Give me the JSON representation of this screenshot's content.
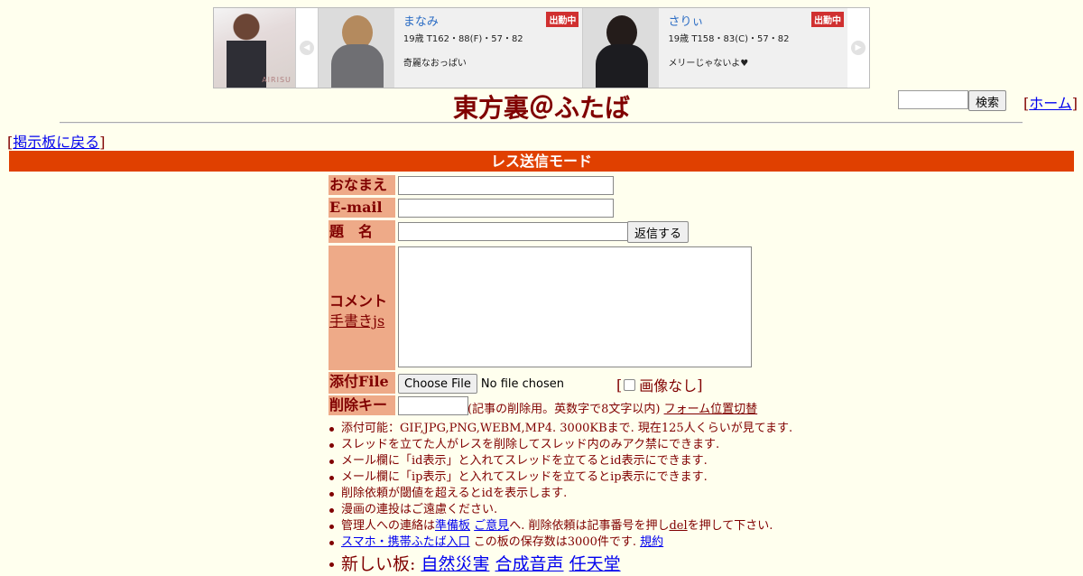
{
  "banner": {
    "shop_logo_text": "AIRISU",
    "prev_arrow": "◀",
    "next_arrow": "▶",
    "girls": [
      {
        "name": "まなみ",
        "spec": "19歳 T162・88(F)・57・82",
        "comment": "奇麗なおっぱい",
        "badge": "出勤中"
      },
      {
        "name": "さりぃ",
        "spec": "19歳 T158・83(C)・57・82",
        "comment": "メリーじゃないよ♥",
        "badge": "出勤中"
      }
    ]
  },
  "header": {
    "title": "東方裏＠ふたば",
    "search_button": "検索",
    "home_link": "ホーム",
    "back_link": "掲示板に戻る"
  },
  "mode_bar": "レス送信モード",
  "form": {
    "name_label": "おなまえ",
    "email_label": "E-mail",
    "subject_label": "題　名",
    "submit_button": "返信する",
    "comment_label": "コメント",
    "handwriting_link": "手書きjs",
    "file_label": "添付File",
    "choose_file_button": "Choose File",
    "no_file_text": "No file chosen",
    "no_image_label": "画像なし",
    "delete_key_label": "削除キー",
    "delete_note": "(記事の削除用。英数字で8文字以内)",
    "form_position_link": "フォーム位置切替"
  },
  "rules": {
    "r1": "添付可能：GIF,JPG,PNG,WEBM,MP4. 3000KBまで. 現在125人くらいが見てます.",
    "r2": "スレッドを立てた人がレスを削除してスレッド内のみアク禁にできます.",
    "r3": "メール欄に「id表示」と入れてスレッドを立てるとid表示にできます.",
    "r4": "メール欄に「ip表示」と入れてスレッドを立てるとip表示にできます.",
    "r5": "削除依頼が閾値を超えるとidを表示します.",
    "r6": "漫画の連投はご遠慮ください.",
    "r7_prefix": "管理人への連絡は",
    "r7_link1": "準備板",
    "r7_link2": "ご意見",
    "r7_mid": "へ. 削除依頼は記事番号を押し",
    "r7_link3": "del",
    "r7_suffix": "を押して下さい.",
    "r8_link": "スマホ・携帯ふたば入口",
    "r8_text": "この板の保存数は3000件です.",
    "r8_link2": "規約",
    "r9_prefix": "新しい板:",
    "r9_boards": [
      "自然災害",
      "合成音声",
      "任天堂"
    ]
  }
}
